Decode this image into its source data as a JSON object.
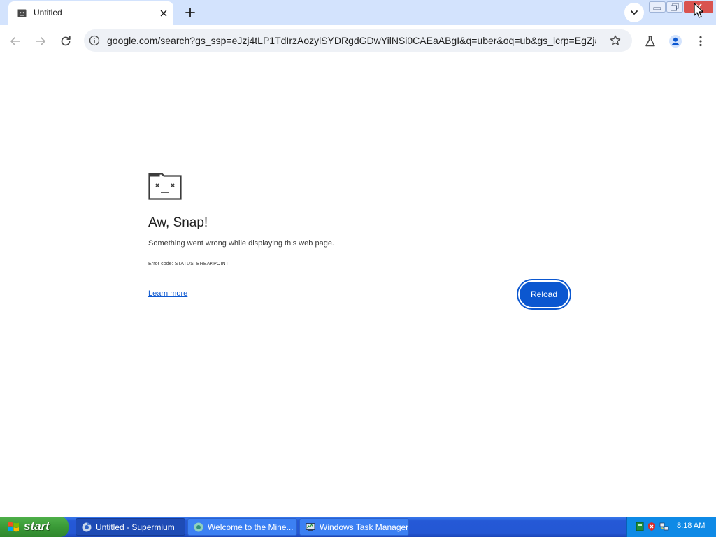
{
  "browser": {
    "tab_title": "Untitled",
    "url": "google.com/search?gs_ssp=eJzj4tLP1TdIrzAozylSYDRgdGDwYilNSi0CAEaABgI&q=uber&oq=ub&gs_lcrp=EgZja..."
  },
  "error_page": {
    "title": "Aw, Snap!",
    "message": "Something went wrong while displaying this web page.",
    "error_code": "Error code: STATUS_BREAKPOINT",
    "learn_more": "Learn more",
    "reload": "Reload"
  },
  "taskbar": {
    "start_label": "start",
    "tasks": [
      {
        "label": "Untitled - Supermium"
      },
      {
        "label": "Welcome to the Mine..."
      },
      {
        "label": "Windows Task Manager"
      }
    ],
    "clock": "8:18 AM"
  },
  "colors": {
    "accent": "#0b57d0",
    "tabstrip": "#d3e3fd",
    "taskbar": "#2457d4",
    "start": "#3a9a37"
  }
}
